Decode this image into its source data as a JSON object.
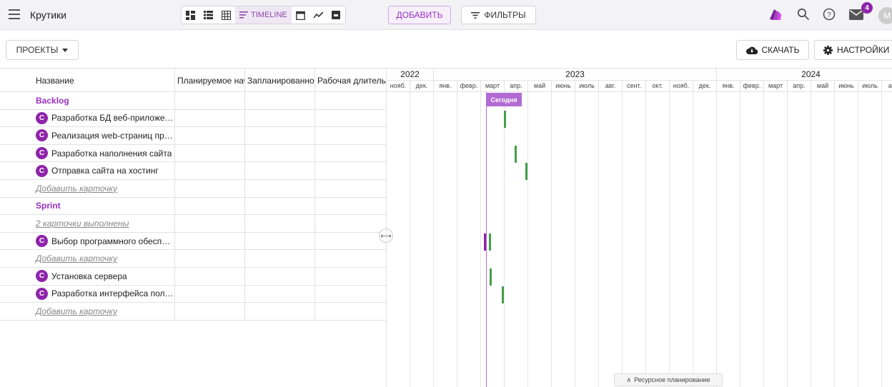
{
  "header": {
    "board_title": "Крутики",
    "timeline_label": "TIMELINE",
    "add_label": "ДОБАВИТЬ",
    "filters_label": "ФИЛЬТРЫ",
    "notifications_count": "4",
    "avatar_letter": "М",
    "accent_color": "#9b2fc5"
  },
  "toolbar": {
    "projects_label": "ПРОЕКТЫ",
    "download_label": "СКАЧАТЬ",
    "settings_label": "НАСТРОЙКИ"
  },
  "table": {
    "columns": [
      "Название",
      "Планируемое начало",
      "Запланированное окончание",
      "Рабочая длительность"
    ],
    "rows": [
      {
        "type": "group",
        "title": "Backlog"
      },
      {
        "type": "card",
        "avatar": "C",
        "title": "Разработка БД веб-приложения"
      },
      {
        "type": "card",
        "avatar": "C",
        "title": "Реализация web-страниц приложения"
      },
      {
        "type": "card",
        "avatar": "C",
        "title": "Разработка наполнения сайта"
      },
      {
        "type": "card",
        "avatar": "C",
        "title": "Отправка сайта на хостинг"
      },
      {
        "type": "link",
        "title": "Добавить карточку"
      },
      {
        "type": "group",
        "title": "Sprint"
      },
      {
        "type": "link",
        "title": "2 карточки выполнены"
      },
      {
        "type": "card",
        "avatar": "C",
        "title": "Выбор программного обеспечения"
      },
      {
        "type": "link",
        "title": "Добавить карточку"
      },
      {
        "type": "card",
        "avatar": "C",
        "title": "Установка сервера"
      },
      {
        "type": "card",
        "avatar": "C",
        "title": "Разработка интерфейса пользователя"
      },
      {
        "type": "link",
        "title": "Добавить карточку"
      }
    ]
  },
  "timeline": {
    "years": [
      "2022",
      "2023",
      "2024"
    ],
    "months": [
      "нояб.",
      "дек.",
      "янв.",
      "февр.",
      "март",
      "апр.",
      "май",
      "июнь",
      "июль",
      "авг.",
      "сент.",
      "окт.",
      "нояб.",
      "дек.",
      "янв.",
      "февр.",
      "март",
      "апр.",
      "май",
      "июнь",
      "июль",
      "авг."
    ],
    "today_label": "Сегодня",
    "resource_label": "Ресурсное планирование"
  }
}
